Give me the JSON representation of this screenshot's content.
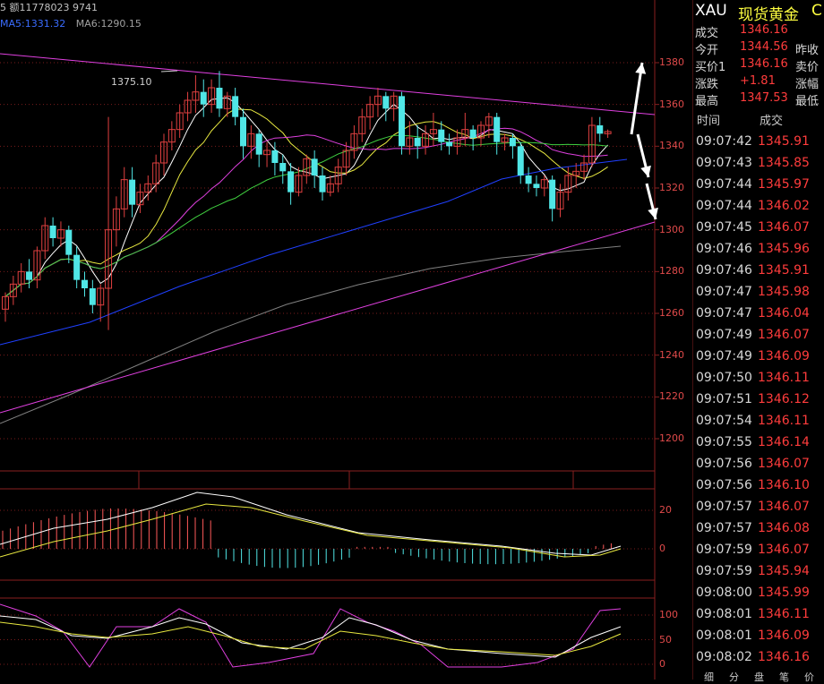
{
  "header": {
    "volume_line": "5 额11778023 9741",
    "ma5_label": "MA5:1331.32",
    "ma6_label": "MA6:1290.15"
  },
  "chart": {
    "price_axis": [
      "1380",
      "1360",
      "1340",
      "1320",
      "1300",
      "1280",
      "1260",
      "1240",
      "1220",
      "1200"
    ],
    "macd_axis": [
      "20",
      "0"
    ],
    "kdj_axis": [
      "100",
      "50",
      "0"
    ],
    "high_annotation": "1375.10",
    "colors": {
      "up": "#e04040",
      "down": "#50e6e6",
      "trendline": "#e040e0",
      "ma5": "#ffffff",
      "ma10": "#e8e840",
      "ma20": "#e040e0",
      "ma30": "#40d040",
      "ma60": "#2040ff",
      "ma120": "#808080"
    }
  },
  "quote": {
    "symbol": "XAU",
    "name": "现货黄金",
    "extra": "C",
    "rows": [
      {
        "label": "成交",
        "value": "1346.16",
        "label2": ""
      },
      {
        "label": "今开",
        "value": "1344.56",
        "label2": "昨收"
      },
      {
        "label": "买价1",
        "value": "1346.16",
        "label2": "卖价"
      },
      {
        "label": "涨跌",
        "value": "+1.81",
        "label2": "涨幅"
      },
      {
        "label": "最高",
        "value": "1347.53",
        "label2": "最低"
      }
    ]
  },
  "ticks": {
    "col_time": "时间",
    "col_price": "成交",
    "rows": [
      {
        "time": "09:07:42",
        "price": "1345.91"
      },
      {
        "time": "09:07:43",
        "price": "1345.85"
      },
      {
        "time": "09:07:44",
        "price": "1345.97"
      },
      {
        "time": "09:07:44",
        "price": "1346.02"
      },
      {
        "time": "09:07:45",
        "price": "1346.07"
      },
      {
        "time": "09:07:46",
        "price": "1345.96"
      },
      {
        "time": "09:07:46",
        "price": "1345.91"
      },
      {
        "time": "09:07:47",
        "price": "1345.98"
      },
      {
        "time": "09:07:47",
        "price": "1346.04"
      },
      {
        "time": "09:07:49",
        "price": "1346.07"
      },
      {
        "time": "09:07:49",
        "price": "1346.09"
      },
      {
        "time": "09:07:50",
        "price": "1346.11"
      },
      {
        "time": "09:07:51",
        "price": "1346.12"
      },
      {
        "time": "09:07:54",
        "price": "1346.11"
      },
      {
        "time": "09:07:55",
        "price": "1346.14"
      },
      {
        "time": "09:07:56",
        "price": "1346.07"
      },
      {
        "time": "09:07:56",
        "price": "1346.10"
      },
      {
        "time": "09:07:57",
        "price": "1346.07"
      },
      {
        "time": "09:07:57",
        "price": "1346.08"
      },
      {
        "time": "09:07:59",
        "price": "1346.07"
      },
      {
        "time": "09:07:59",
        "price": "1345.94"
      },
      {
        "time": "09:08:00",
        "price": "1345.99"
      },
      {
        "time": "09:08:01",
        "price": "1346.11"
      },
      {
        "time": "09:08:01",
        "price": "1346.09"
      },
      {
        "time": "09:08:02",
        "price": "1346.16"
      }
    ]
  },
  "tabs": [
    "细",
    "分",
    "盘",
    "笔",
    "价"
  ]
}
